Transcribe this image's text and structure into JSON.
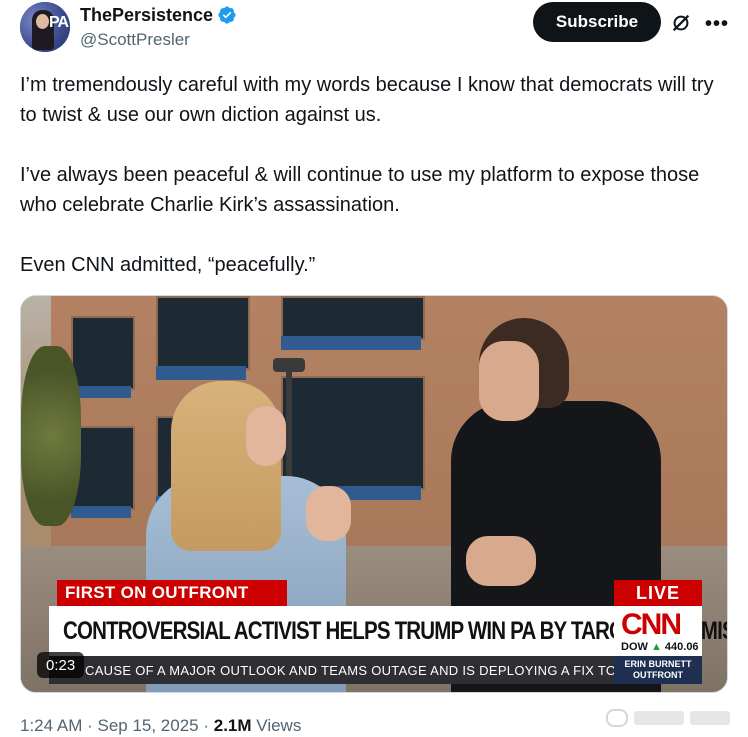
{
  "author": {
    "display_name": "ThePersistence",
    "handle": "@ScottPresler",
    "verified": true,
    "avatar_text": "PA"
  },
  "actions": {
    "subscribe_label": "Subscribe",
    "grok_icon": "grok-icon",
    "more_icon": "more-icon"
  },
  "tweet": {
    "paragraphs": [
      "I’m tremendously careful with my words because I know that democrats will try to twist & use our own diction against us.",
      "I’ve always been peaceful & will continue to use my platform to expose those who celebrate Charlie Kirk’s assassination.",
      "Even CNN admitted, “peacefully.”"
    ]
  },
  "video": {
    "duration_badge": "0:23",
    "chyron": {
      "label": "FIRST ON OUTFRONT",
      "live": "LIVE",
      "headline": "CONTROVERSIAL ACTIVIST HELPS TRUMP WIN PA BY TARGETING AMISH",
      "network": "CNN",
      "dow_label": "DOW",
      "dow_value": "440.06",
      "ticker": "CAUSE OF A MAJOR OUTLOOK AND TEAMS OUTAGE AND IS DEPLOYING A FIX TO THE",
      "show_line1": "ERIN BURNETT",
      "show_line2": "OUTFRONT"
    }
  },
  "meta": {
    "time": "1:24 AM",
    "separator": " · ",
    "date": "Sep 15, 2025",
    "views_count": "2.1M",
    "views_label": "Views"
  },
  "colors": {
    "accent_verified": "#1d9bf0",
    "cnn_red": "#cc0000",
    "text_secondary": "#536471"
  }
}
